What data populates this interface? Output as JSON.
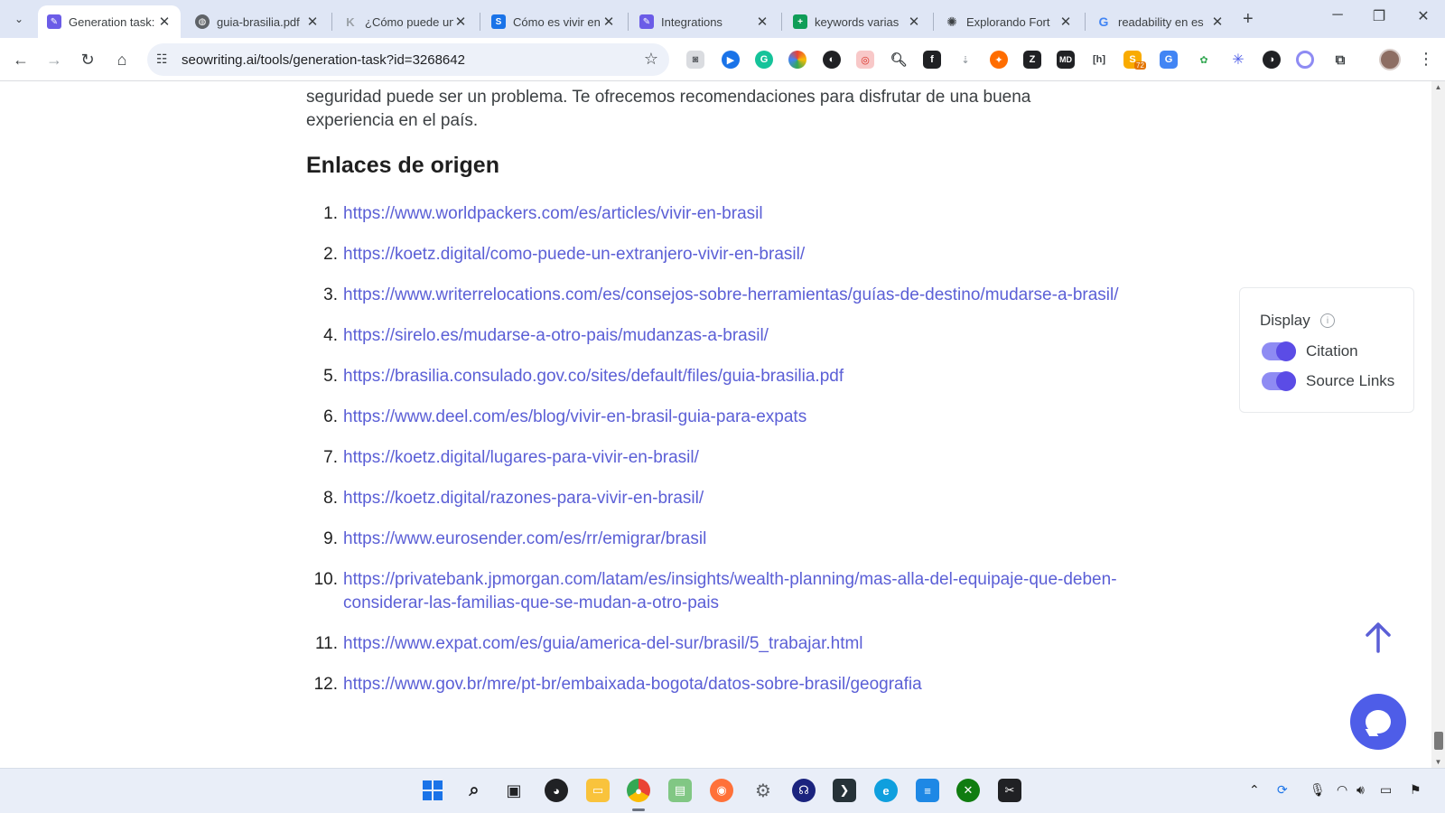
{
  "browser": {
    "tabs": [
      {
        "title": "Generation task:",
        "icon": "seowriting-icon",
        "active": true
      },
      {
        "title": "guia-brasilia.pdf",
        "icon": "globe-icon",
        "active": false
      },
      {
        "title": "¿Cómo puede un",
        "icon": "koetz-icon",
        "active": false
      },
      {
        "title": "Cómo es vivir en",
        "icon": "site-icon",
        "active": false
      },
      {
        "title": "Integrations",
        "icon": "seowriting-icon",
        "active": false
      },
      {
        "title": "keywords varias",
        "icon": "sheets-icon",
        "active": false
      },
      {
        "title": "Explorando Fort",
        "icon": "openai-icon",
        "active": false
      },
      {
        "title": "readability en es",
        "icon": "google-icon",
        "active": false
      }
    ],
    "url": "seowriting.ai/tools/generation-task?id=3268642",
    "extension_badge": "72"
  },
  "article": {
    "intro_text": "seguridad puede ser un problema. Te ofrecemos recomendaciones para disfrutar de una buena experiencia en el país.",
    "heading": "Enlaces de origen",
    "links": [
      {
        "num": "1.",
        "url": "https://www.worldpackers.com/es/articles/vivir-en-brasil"
      },
      {
        "num": "2.",
        "url": "https://koetz.digital/como-puede-un-extranjero-vivir-en-brasil/"
      },
      {
        "num": "3.",
        "url": "https://www.writerrelocations.com/es/consejos-sobre-herramientas/guías-de-destino/mudarse-a-brasil/"
      },
      {
        "num": "4.",
        "url": "https://sirelo.es/mudarse-a-otro-pais/mudanzas-a-brasil/"
      },
      {
        "num": "5.",
        "url": "https://brasilia.consulado.gov.co/sites/default/files/guia-brasilia.pdf"
      },
      {
        "num": "6.",
        "url": "https://www.deel.com/es/blog/vivir-en-brasil-guia-para-expats"
      },
      {
        "num": "7.",
        "url": "https://koetz.digital/lugares-para-vivir-en-brasil/"
      },
      {
        "num": "8.",
        "url": "https://koetz.digital/razones-para-vivir-en-brasil/"
      },
      {
        "num": "9.",
        "url": "https://www.eurosender.com/es/rr/emigrar/brasil"
      },
      {
        "num": "10.",
        "url": "https://privatebank.jpmorgan.com/latam/es/insights/wealth-planning/mas-alla-del-equipaje-que-deben-considerar-las-familias-que-se-mudan-a-otro-pais"
      },
      {
        "num": "11.",
        "url": "https://www.expat.com/es/guia/america-del-sur/brasil/5_trabajar.html"
      },
      {
        "num": "12.",
        "url": "https://www.gov.br/mre/pt-br/embaixada-bogota/datos-sobre-brasil/geografia"
      }
    ]
  },
  "display_panel": {
    "title": "Display",
    "toggles": [
      {
        "label": "Citation",
        "on": true
      },
      {
        "label": "Source Links",
        "on": true
      }
    ]
  },
  "colors": {
    "link": "#5b5fd6",
    "accent": "#5b4ce6",
    "chat_button": "#4e5de8"
  }
}
